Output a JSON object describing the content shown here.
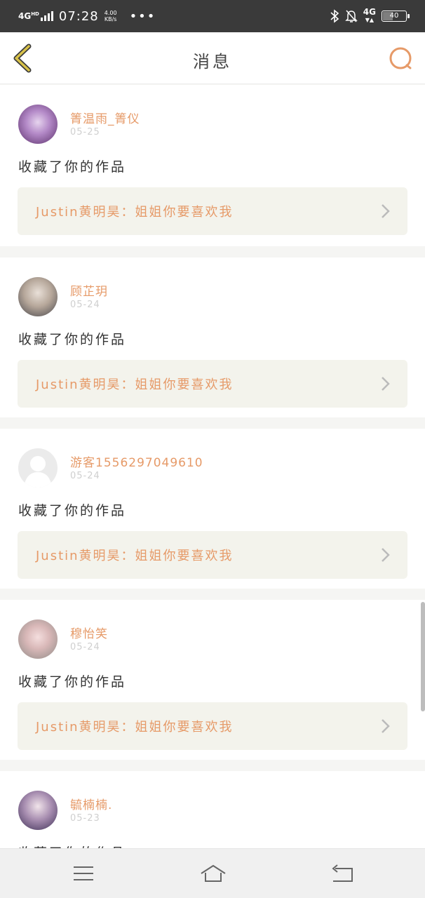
{
  "status_bar": {
    "network": "4G",
    "network_sup": "HD",
    "time": "07:28",
    "speed_value": "4.00",
    "speed_unit": "KB/s",
    "more": "•••",
    "right_network": "4G",
    "battery": "40",
    "battery_level": 0.4
  },
  "header": {
    "title": "消息"
  },
  "colors": {
    "accent": "#e69a68",
    "back_arrow": "#d8c24a"
  },
  "messages": [
    {
      "username": "箐温雨_箐仪",
      "date": "05-25",
      "action": "收藏了你的作品",
      "work": "Justin黄明昊：姐姐你要喜欢我"
    },
    {
      "username": "顾芷玥",
      "date": "05-24",
      "action": "收藏了你的作品",
      "work": "Justin黄明昊：姐姐你要喜欢我"
    },
    {
      "username": "游客1556297049610",
      "date": "05-24",
      "action": "收藏了你的作品",
      "work": "Justin黄明昊：姐姐你要喜欢我"
    },
    {
      "username": "穆怡笑",
      "date": "05-24",
      "action": "收藏了你的作品",
      "work": "Justin黄明昊：姐姐你要喜欢我"
    },
    {
      "username": "毓楠楠.",
      "date": "05-23",
      "action": "收藏了你的作品",
      "work": ""
    }
  ],
  "nav": {
    "icons": [
      "menu-icon",
      "home-icon",
      "back-icon"
    ]
  }
}
